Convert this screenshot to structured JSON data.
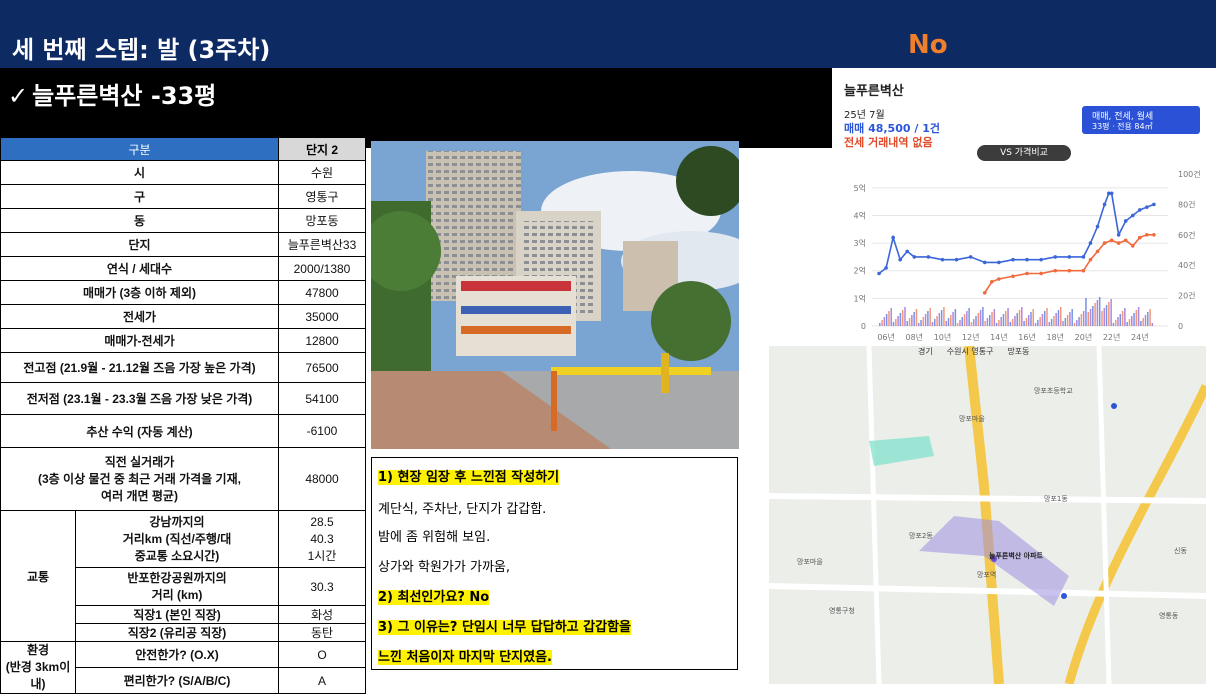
{
  "header": {
    "title": "세 번째 스텝: 발 (3주차)",
    "verdict": "No"
  },
  "subtitle": {
    "check": "✓",
    "text": "늘푸른벽산 -33평"
  },
  "table": {
    "col1": "구분",
    "col2": "단지 2",
    "rows": [
      {
        "label": "시",
        "value": "수원"
      },
      {
        "label": "구",
        "value": "영통구"
      },
      {
        "label": "동",
        "value": "망포동"
      },
      {
        "label": "단지",
        "value": "늘푸른벽산33"
      },
      {
        "label": "연식 / 세대수",
        "value": "2000/1380"
      },
      {
        "label": "매매가 (3층 이하 제외)",
        "value": "47800"
      },
      {
        "label": "전세가",
        "value": "35000"
      },
      {
        "label": "매매가-전세가",
        "value": "12800"
      },
      {
        "label": "전고점 (21.9월 - 21.12월 즈음 가장 높은 가격)",
        "value": "76500"
      },
      {
        "label": "전저점 (23.1월 - 23.3월 즈음 가장 낮은 가격)",
        "value": "54100"
      },
      {
        "label": "추산 수익 (자동 계산)",
        "value": "-6100"
      },
      {
        "label": "직전 실거래가\n(3층 이상 물건 중 최근 거래 가격을 기재,\n여러 개면 평균)",
        "value": "48000"
      }
    ],
    "transport": {
      "group": "교통",
      "gangnam_label": "강남까지의\n거리km (직선/주행/대\n중교통 소요시간)",
      "gangnam_values": "28.5\n40.3\n1시간",
      "park_label": "반포한강공원까지의\n거리 (km)",
      "park_value": "30.3",
      "job1_label": "직장1 (본인 직장)",
      "job1_value": "화성",
      "job2_label": "직장2 (유리공 직장)",
      "job2_value": "동탄"
    },
    "env": {
      "group": "환경\n(반경 3km이내)",
      "safe_label": "안전한가? (O.X)",
      "safe_value": "O",
      "conv_label": "편리한가? (S/A/B/C)",
      "conv_value": "A"
    }
  },
  "notes": {
    "q1": "1) 현장 임장 후 느낀점 작성하기",
    "a1": "계단식, 주차난, 단지가 갑갑함.",
    "a2": "밤에 좀 위험해 보임.",
    "a3": "상가와 학원가가 가까움,",
    "q2": "2) 최선인가요? No",
    "q3": "3) 그 이유는? 단임시 너무 답답하고 갑갑함을",
    "q3b": "느낀 처음이자 마지막 단지였음."
  },
  "panel": {
    "name": "늘푸른벽산",
    "date": "25년 7월",
    "sale": "매매 48,500 / 1건",
    "lease": "전세 거래내역 없음",
    "filter1": "매매, 전세, 월세",
    "filter2": "33평 · 전용 84㎡",
    "vs": "VS 가격비교"
  },
  "chart_data": {
    "type": "line",
    "x_ticks": [
      "06년",
      "08년",
      "10년",
      "12년",
      "14년",
      "16년",
      "18년",
      "20년",
      "22년",
      "24년"
    ],
    "y_left_ticks": [
      "0",
      "1억",
      "2억",
      "3억",
      "4억",
      "5억"
    ],
    "y_right_ticks": [
      "0",
      "20건",
      "40건",
      "60건",
      "80건",
      "100건"
    ],
    "ylim_left": [
      0,
      5.5
    ],
    "series": [
      {
        "name": "매매",
        "color": "#3a66d9",
        "x": [
          2005.5,
          2006,
          2006.5,
          2007,
          2007.5,
          2008,
          2009,
          2010,
          2011,
          2012,
          2013,
          2014,
          2015,
          2016,
          2017,
          2018,
          2019,
          2020,
          2020.5,
          2021,
          2021.5,
          2021.8,
          2022,
          2022.5,
          2023,
          2023.5,
          2024,
          2024.5,
          2025
        ],
        "y": [
          1.9,
          2.1,
          3.2,
          2.4,
          2.7,
          2.5,
          2.5,
          2.4,
          2.4,
          2.5,
          2.3,
          2.3,
          2.4,
          2.4,
          2.4,
          2.5,
          2.5,
          2.5,
          3.0,
          3.6,
          4.4,
          4.8,
          4.8,
          3.3,
          3.8,
          4.0,
          4.2,
          4.3,
          4.4
        ]
      },
      {
        "name": "전세",
        "color": "#ef6a3d",
        "x": [
          2013,
          2013.5,
          2014,
          2015,
          2016,
          2017,
          2018,
          2019,
          2020,
          2020.5,
          2021,
          2021.5,
          2022,
          2022.5,
          2023,
          2023.5,
          2024,
          2024.5,
          2025
        ],
        "y": [
          1.2,
          1.6,
          1.7,
          1.8,
          1.9,
          1.9,
          2.0,
          2.0,
          2.0,
          2.4,
          2.7,
          3.0,
          3.1,
          3.0,
          3.1,
          2.9,
          3.2,
          3.3,
          3.3
        ]
      }
    ]
  },
  "map": {
    "search": [
      "경기",
      "수원시 영통구",
      "망포동"
    ],
    "labels": [
      "망포마을",
      "망포1동",
      "망포2동",
      "망포역",
      "영통구청",
      "망포마을",
      "영통동",
      "신동",
      "망포초등학교",
      "늘푸른벽산 아파트"
    ]
  },
  "colors": {
    "header_bg": "#0e2a63",
    "verdict": "#f07f2c",
    "highlight": "#fff200",
    "table_header": "#2f6fc2"
  }
}
